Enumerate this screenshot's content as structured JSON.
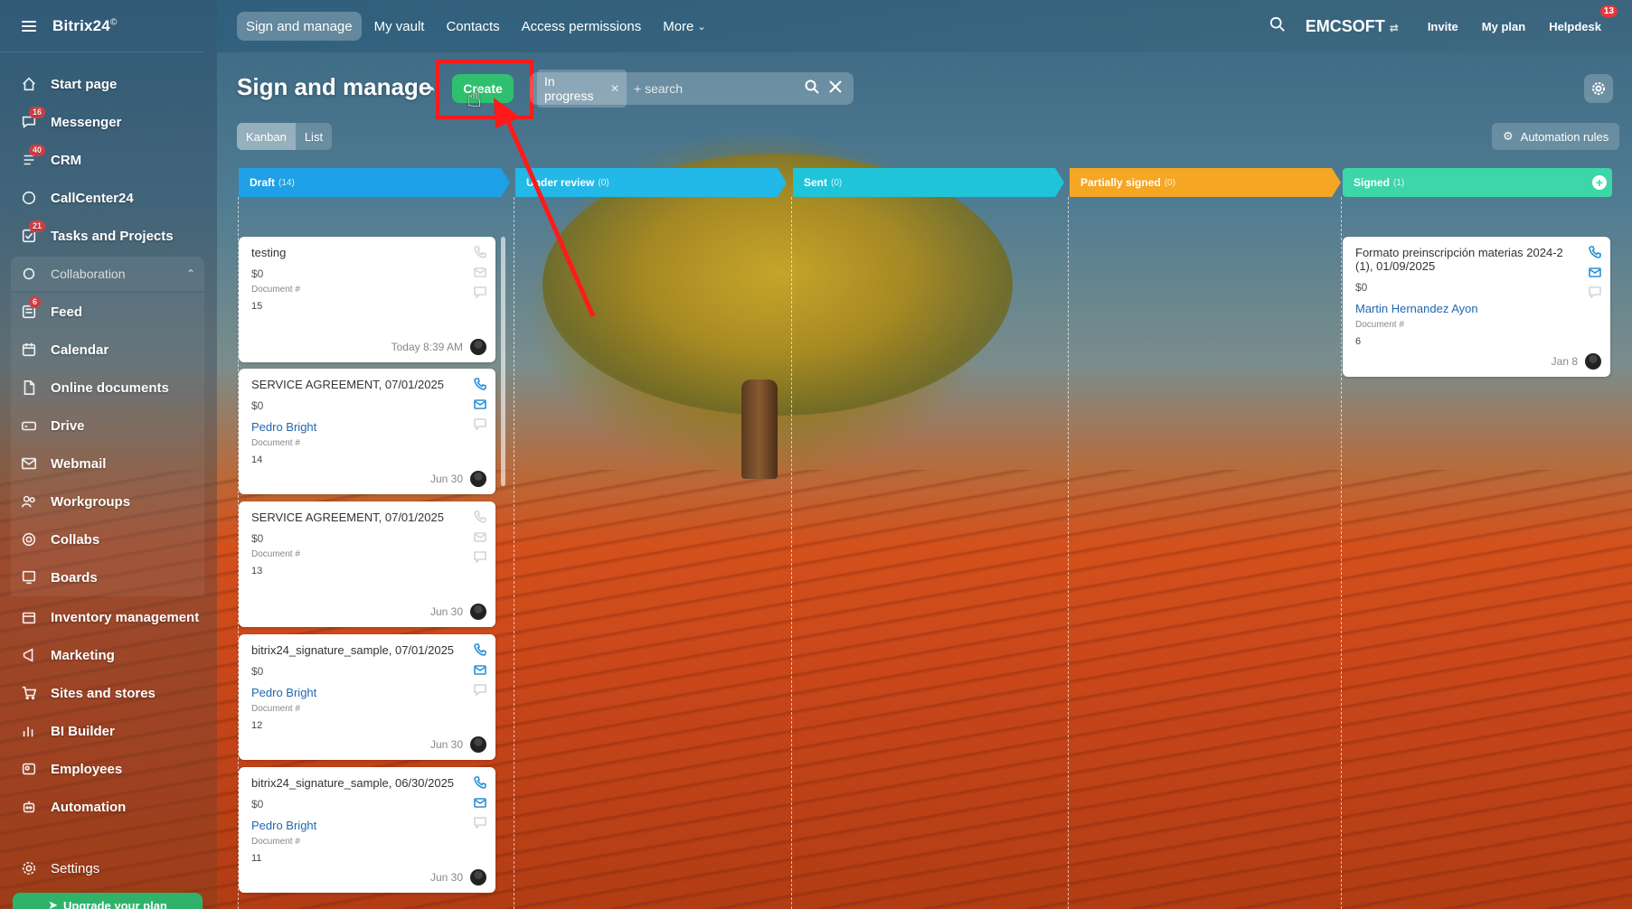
{
  "brand": {
    "name": "Bitrix24",
    "sup": "©"
  },
  "sidebar": {
    "items": [
      {
        "label": "Start page",
        "icon": "home-icon",
        "badge": ""
      },
      {
        "label": "Messenger",
        "icon": "chat-icon",
        "badge": "16"
      },
      {
        "label": "CRM",
        "icon": "crm-icon",
        "badge": "40"
      },
      {
        "label": "CallCenter24",
        "icon": "phone-icon",
        "badge": ""
      },
      {
        "label": "Tasks and Projects",
        "icon": "tasks-icon",
        "badge": "21"
      }
    ],
    "group": {
      "label": "Collaboration"
    },
    "group_items": [
      {
        "label": "Feed",
        "icon": "feed-icon",
        "badge": "6"
      },
      {
        "label": "Calendar",
        "icon": "calendar-icon",
        "badge": ""
      },
      {
        "label": "Online documents",
        "icon": "document-icon",
        "badge": ""
      },
      {
        "label": "Drive",
        "icon": "drive-icon",
        "badge": ""
      },
      {
        "label": "Webmail",
        "icon": "mail-icon",
        "badge": ""
      },
      {
        "label": "Workgroups",
        "icon": "group-icon",
        "badge": ""
      },
      {
        "label": "Collabs",
        "icon": "collab-icon",
        "badge": ""
      },
      {
        "label": "Boards",
        "icon": "board-icon",
        "badge": ""
      }
    ],
    "more_items": [
      {
        "label": "Inventory management",
        "icon": "inventory-icon"
      },
      {
        "label": "Marketing",
        "icon": "marketing-icon"
      },
      {
        "label": "Sites and stores",
        "icon": "cart-icon"
      },
      {
        "label": "BI Builder",
        "icon": "chart-icon"
      },
      {
        "label": "Employees",
        "icon": "employees-icon"
      },
      {
        "label": "Automation",
        "icon": "robot-icon"
      }
    ],
    "settings": "Settings",
    "upgrade": "Upgrade your plan"
  },
  "topbar": {
    "tabs": [
      "Sign and manage",
      "My vault",
      "Contacts",
      "Access permissions",
      "More"
    ],
    "company": "EMCSOFT",
    "invite": "Invite",
    "my_plan": "My plan",
    "helpdesk": "Helpdesk",
    "helpdesk_badge": "13"
  },
  "page": {
    "title": "Sign and manage",
    "create": "Create",
    "filter_chip": "In progress",
    "search_placeholder": "+ search",
    "views": [
      "Kanban",
      "List"
    ],
    "automation": "Automation rules"
  },
  "columns": [
    {
      "name": "Draft",
      "count": "(14)",
      "color": "#1ea0e6"
    },
    {
      "name": "Under review",
      "count": "(0)",
      "color": "#22b8e8"
    },
    {
      "name": "Sent",
      "count": "(0)",
      "color": "#1fc4d8"
    },
    {
      "name": "Partially signed",
      "count": "(0)",
      "color": "#f5a623"
    },
    {
      "name": "Signed",
      "count": "(1)",
      "color": "#3dd6a8"
    }
  ],
  "draft_cards": [
    {
      "title": "testing",
      "amount": "$0",
      "contact": "",
      "doc_label": "Document #",
      "doc_num": "15",
      "date": "Today 8:39 AM",
      "active": false
    },
    {
      "title": "SERVICE AGREEMENT, 07/01/2025",
      "amount": "$0",
      "contact": "Pedro Bright",
      "doc_label": "Document #",
      "doc_num": "14",
      "date": "Jun 30",
      "active": true
    },
    {
      "title": "SERVICE AGREEMENT, 07/01/2025",
      "amount": "$0",
      "contact": "",
      "doc_label": "Document #",
      "doc_num": "13",
      "date": "Jun 30",
      "active": false
    },
    {
      "title": "bitrix24_signature_sample, 07/01/2025",
      "amount": "$0",
      "contact": "Pedro Bright",
      "doc_label": "Document #",
      "doc_num": "12",
      "date": "Jun 30",
      "active": true
    },
    {
      "title": "bitrix24_signature_sample, 06/30/2025",
      "amount": "$0",
      "contact": "Pedro Bright",
      "doc_label": "Document #",
      "doc_num": "11",
      "date": "Jun 30",
      "active": true
    }
  ],
  "signed_card": {
    "title": "Formato preinscripción materias 2024-2 (1), 01/09/2025",
    "amount": "$0",
    "contact": "Martin Hernandez Ayon",
    "doc_label": "Document #",
    "doc_num": "6",
    "date": "Jan 8"
  }
}
